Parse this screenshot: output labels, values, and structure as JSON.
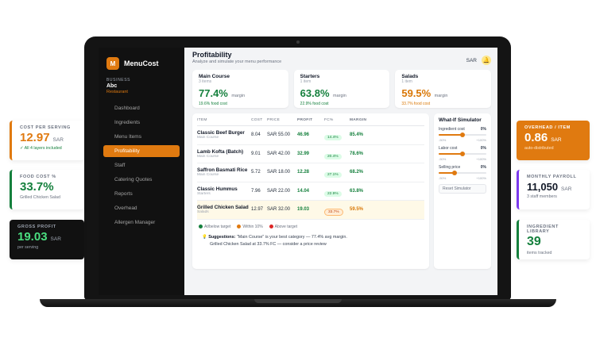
{
  "app": {
    "brand": "MenuCost",
    "logo_letter": "M"
  },
  "business": {
    "label": "BUSINESS",
    "name": "Abc",
    "subtitle": "Restaurant"
  },
  "nav": [
    {
      "label": "Dashboard",
      "active": false
    },
    {
      "label": "Ingredients",
      "active": false
    },
    {
      "label": "Menu Items",
      "active": false
    },
    {
      "label": "Profitability",
      "active": true
    },
    {
      "label": "Staff",
      "active": false
    },
    {
      "label": "Catering Quotes",
      "active": false
    },
    {
      "label": "Reports",
      "active": false
    },
    {
      "label": "Overhead",
      "active": false
    },
    {
      "label": "Allergen Manager",
      "active": false
    }
  ],
  "header": {
    "title": "Profitability",
    "subtitle": "Analyze and simulate your menu performance",
    "currency": "SAR",
    "bell_icon": "bell-icon"
  },
  "categories": [
    {
      "name": "Main Course",
      "items": "3 items",
      "margin": "77.4%",
      "margin_label": "margin",
      "food_cost": "19.6% food cost",
      "color": "#15803d"
    },
    {
      "name": "Starters",
      "items": "1 item",
      "margin": "63.8%",
      "margin_label": "margin",
      "food_cost": "22.9% food cost",
      "color": "#15803d"
    },
    {
      "name": "Salads",
      "items": "1 item",
      "margin": "59.5%",
      "margin_label": "margin",
      "food_cost": "33.7% food cost",
      "color": "#d97706"
    }
  ],
  "table": {
    "headers": {
      "item": "ITEM",
      "cost": "COST",
      "price": "PRICE",
      "profit": "PROFIT",
      "fc": "FC%",
      "margin": "MARGIN"
    },
    "rows": [
      {
        "name": "Classic Beef Burger",
        "category": "Main Course",
        "cost": "8.04",
        "price": "SAR 55.00",
        "profit": "46.96",
        "fc": "14.4%",
        "margin": "85.4%",
        "status": "g"
      },
      {
        "name": "Lamb Kofta (Batch)",
        "category": "Main Course",
        "cost": "9.01",
        "price": "SAR 42.00",
        "profit": "32.99",
        "fc": "20.4%",
        "margin": "78.6%",
        "status": "g"
      },
      {
        "name": "Saffron Basmati Rice",
        "category": "Main Course",
        "cost": "5.72",
        "price": "SAR 18.00",
        "profit": "12.28",
        "fc": "27.1%",
        "margin": "68.2%",
        "status": "g"
      },
      {
        "name": "Classic Hummus",
        "category": "Starters",
        "cost": "7.96",
        "price": "SAR 22.00",
        "profit": "14.04",
        "fc": "22.9%",
        "margin": "63.8%",
        "status": "g"
      },
      {
        "name": "Grilled Chicken Salad",
        "category": "Salads",
        "cost": "12.97",
        "price": "SAR 32.00",
        "profit": "19.03",
        "fc": "33.7%",
        "margin": "59.5%",
        "status": "o"
      }
    ]
  },
  "legend": [
    {
      "label": "At/below target",
      "color": "#15803d"
    },
    {
      "label": "Within 10%",
      "color": "#e07a10"
    },
    {
      "label": "Above target",
      "color": "#dc2626"
    }
  ],
  "suggestions": {
    "label": "Suggestions:",
    "line1": "\"Main Course\" is your best category — 77.4% avg margin.",
    "line2": "Grilled Chicken Salad at 33.7% FC — consider a price review"
  },
  "simulator": {
    "title": "What-If Simulator",
    "sliders": [
      {
        "label": "Ingredient cost",
        "value": "0%",
        "level": 0.5,
        "min": "-50%",
        "max": "+100%"
      },
      {
        "label": "Labor cost",
        "value": "0%",
        "level": 0.5,
        "min": "-50%",
        "max": "+100%"
      },
      {
        "label": "Selling price",
        "value": "0%",
        "level": 0.33,
        "min": "-50%",
        "max": "+100%"
      }
    ],
    "reset_label": "Reset Simulator"
  },
  "floats": {
    "cost_per_serving": {
      "label": "COST PER SERVING",
      "value": "12.97",
      "unit": "SAR",
      "sub": "✓ All 4 layers included"
    },
    "food_cost": {
      "label": "FOOD COST %",
      "value": "33.7%",
      "sub": "Grilled Chicken Salad"
    },
    "gross_profit": {
      "label": "GROSS PROFIT",
      "value": "19.03",
      "unit": "SAR",
      "sub": "per serving"
    },
    "overhead": {
      "label": "OVERHEAD / ITEM",
      "value": "0.86",
      "unit": "SAR",
      "sub": "auto-distributed"
    },
    "payroll": {
      "label": "MONTHLY PAYROLL",
      "value": "11,050",
      "unit": "SAR",
      "sub": "3 staff members"
    },
    "ingredients": {
      "label": "INGREDIENT LIBRARY",
      "value": "39",
      "sub": "items tracked"
    }
  }
}
